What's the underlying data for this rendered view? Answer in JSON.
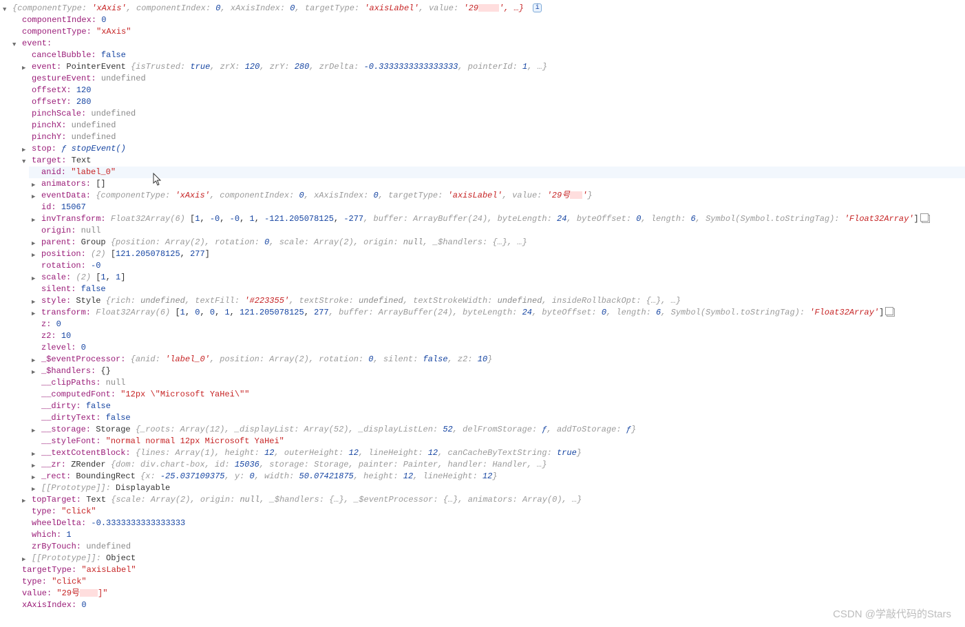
{
  "top": {
    "summary_prefix": "{componentType: ",
    "ct": "'xAxis'",
    "ci": "componentIndex: ",
    "ci_v": "0",
    "xi": "xAxisIndex: ",
    "xi_v": "0",
    "tt": "targetType: ",
    "tt_v": "'axisLabel'",
    "val": "value: ",
    "val_v": "'29",
    "val_tail": "', …}"
  },
  "kv": {
    "componentIndex": "componentIndex:",
    "componentIndex_v": "0",
    "componentType": "componentType:",
    "componentType_v": "\"xAxis\"",
    "event": "event:",
    "cancelBubble": "cancelBubble:",
    "cancelBubble_v": "false",
    "event2": "event:",
    "event2_cls": "PointerEvent ",
    "event2_body": "{isTrusted: ",
    "isTrusted": "true",
    "zrX": ", zrX: ",
    "zrX_v": "120",
    "zrY": ", zrY: ",
    "zrY_v": "280",
    "zrDelta": ", zrDelta: ",
    "zrDelta_v": "-0.3333333333333333",
    "pointerId": ", pointerId: ",
    "pointerId_v": "1",
    "tail": ", …}",
    "gestureEvent": "gestureEvent:",
    "undef": "undefined",
    "offsetX": "offsetX:",
    "offsetX_v": "120",
    "offsetY": "offsetY:",
    "offsetY_v": "280",
    "pinchScale": "pinchScale:",
    "pinchX": "pinchX:",
    "pinchY": "pinchY:",
    "stop": "stop:",
    "stop_fn": "ƒ ",
    "stop_name": "stopEvent()",
    "target": "target:",
    "target_cls": "Text",
    "anid": "anid:",
    "anid_v": "\"label_0\"",
    "animators": "animators:",
    "animators_v": "[]",
    "eventData": "eventData:",
    "id": "id:",
    "id_v": "15067",
    "invTransform": "invTransform:",
    "origin": "origin:",
    "null": "null",
    "parent": "parent:",
    "position": "position:",
    "rotation": "rotation:",
    "rotation_v": "-0",
    "scale": "scale:",
    "silent": "silent:",
    "silent_v": "false",
    "style": "style:",
    "transform": "transform:",
    "z": "z:",
    "z_v": "0",
    "z2": "z2:",
    "z2_v": "10",
    "zlevel": "zlevel:",
    "zlevel_v": "0",
    "sEventProcessor": "_$eventProcessor:",
    "sHandlers": "_$handlers:",
    "sHandlers_v": "{}",
    "clipPaths": "__clipPaths:",
    "computedFont": "__computedFont:",
    "computedFont_v": "\"12px \\\"Microsoft YaHei\\\"\"",
    "dirty": "__dirty:",
    "dirty_v": "false",
    "dirtyText": "__dirtyText:",
    "dirtyText_v": "false",
    "storage": "__storage:",
    "styleFont": "__styleFont:",
    "styleFont_v": "\"normal normal 12px Microsoft YaHei\"",
    "textCotentBlock": "__textCotentBlock:",
    "zr": "__zr:",
    "rect": "_rect:",
    "proto": "[[Prototype]]:",
    "proto_v": "Displayable",
    "topTarget": "topTarget:",
    "type": "type:",
    "type_v": "\"click\"",
    "wheelDelta": "wheelDelta:",
    "wheelDelta_v": "-0.3333333333333333",
    "which": "which:",
    "which_v": "1",
    "zrByTouch": "zrByTouch:",
    "proto2_v": "Object",
    "targetType": "targetType:",
    "targetType_v": "\"axisLabel\"",
    "value": "value:",
    "value_v_pre": "\"29",
    "value_v_post": "]\"",
    "xAxisIndex": "xAxisIndex:",
    "xAxisIndex_v": "0"
  },
  "eventData": {
    "open": "{componentType: ",
    "ct": "'xAxis'",
    "ci": ", componentIndex: ",
    "ci_v": "0",
    "xi": ", xAxisIndex: ",
    "xi_v": "0",
    "tt": ", targetType: ",
    "tt_v": "'axisLabel'",
    "val": ", value: ",
    "val_v_pre": "'29",
    "val_v_post": "'",
    "close": "}"
  },
  "invTransform": {
    "cls": "Float32Array(6) ",
    "open": "[",
    "n0": "1",
    "n1": "-0",
    "n2": "-0",
    "n3": "1",
    "n4": "-121.205078125",
    "n5": "-277",
    "buf": ", buffer: ",
    "buf_v": "ArrayBuffer(24)",
    "bl": ", byteLength: ",
    "bl_v": "24",
    "bo": ", byteOffset: ",
    "bo_v": "0",
    "len": ", length: ",
    "len_v": "6",
    "sym": ", Symbol(Symbol.toStringTag): ",
    "sym_v": "'Float32Array'",
    "close": "]"
  },
  "parent": {
    "cls": "Group ",
    "body": "{position: Array(2), rotation: ",
    "rot": "0",
    "scale": ", scale: Array(2), origin: ",
    "origin": "null",
    "rest": ", _$handlers: {…}, …}"
  },
  "position": {
    "dim": "(2) ",
    "open": "[",
    "n0": "121.205078125",
    "n1": "277",
    "close": "]"
  },
  "scale": {
    "dim": "(2) ",
    "open": "[",
    "n0": "1",
    "n1": "1",
    "close": "]"
  },
  "style": {
    "cls": "Style ",
    "open": "{rich: ",
    "rich": "undefined",
    "tf": ", textFill: ",
    "tf_v": "'#223355'",
    "ts": ", textStroke: ",
    "ts_v": "undefined",
    "tsw": ", textStrokeWidth: ",
    "tsw_v": "undefined",
    "rest": ", insideRollbackOpt: {…}, …}"
  },
  "transform": {
    "cls": "Float32Array(6) ",
    "open": "[",
    "n0": "1",
    "n1": "0",
    "n2": "0",
    "n3": "1",
    "n4": "121.205078125",
    "n5": "277",
    "buf": ", buffer: ",
    "buf_v": "ArrayBuffer(24)",
    "bl": ", byteLength: ",
    "bl_v": "24",
    "bo": ", byteOffset: ",
    "bo_v": "0",
    "len": ", length: ",
    "len_v": "6",
    "sym": ", Symbol(Symbol.toStringTag): ",
    "sym_v": "'Float32Array'",
    "close": "]"
  },
  "sEventProcessor": {
    "open": "{anid: ",
    "anid": "'label_0'",
    "pos": ", position: Array(2), rotation: ",
    "rot": "0",
    "sil": ", silent: ",
    "sil_v": "false",
    "z2": ", z2: ",
    "z2_v": "10",
    "close": "}"
  },
  "storage": {
    "cls": "Storage ",
    "body": "{_roots: Array(12), _displayList: Array(52), _displayListLen: ",
    "dll": "52",
    "rest": ", delFromStorage: ",
    "fn": "ƒ",
    "add": ", addToStorage: ",
    "close": "}"
  },
  "textCotentBlock": {
    "open": "{lines: Array(1), height: ",
    "h": "12",
    "oh": ", outerHeight: ",
    "oh_v": "12",
    "lh": ", lineHeight: ",
    "lh_v": "12",
    "cc": ", canCacheByTextString: ",
    "cc_v": "true",
    "close": "}"
  },
  "zr": {
    "cls": "ZRender ",
    "body": "{dom: div.chart-box, id: ",
    "id": "15036",
    "st": ", storage: Storage, painter: Painter, handler: Handler, …}"
  },
  "rect": {
    "cls": "BoundingRect ",
    "open": "{x: ",
    "x": "-25.037109375",
    "y": ", y: ",
    "y_v": "0",
    "w": ", width: ",
    "w_v": "50.07421875",
    "h": ", height: ",
    "h_v": "12",
    "lh": ", lineHeight: ",
    "lh_v": "12",
    "close": "}"
  },
  "topTarget": {
    "cls": "Text ",
    "body": "{scale: Array(2), origin: ",
    "origin": "null",
    "rest": ", _$handlers: {…}, _$eventProcessor: {…}, animators: Array(0), …}"
  },
  "watermark": "CSDN @学敲代码的Stars"
}
